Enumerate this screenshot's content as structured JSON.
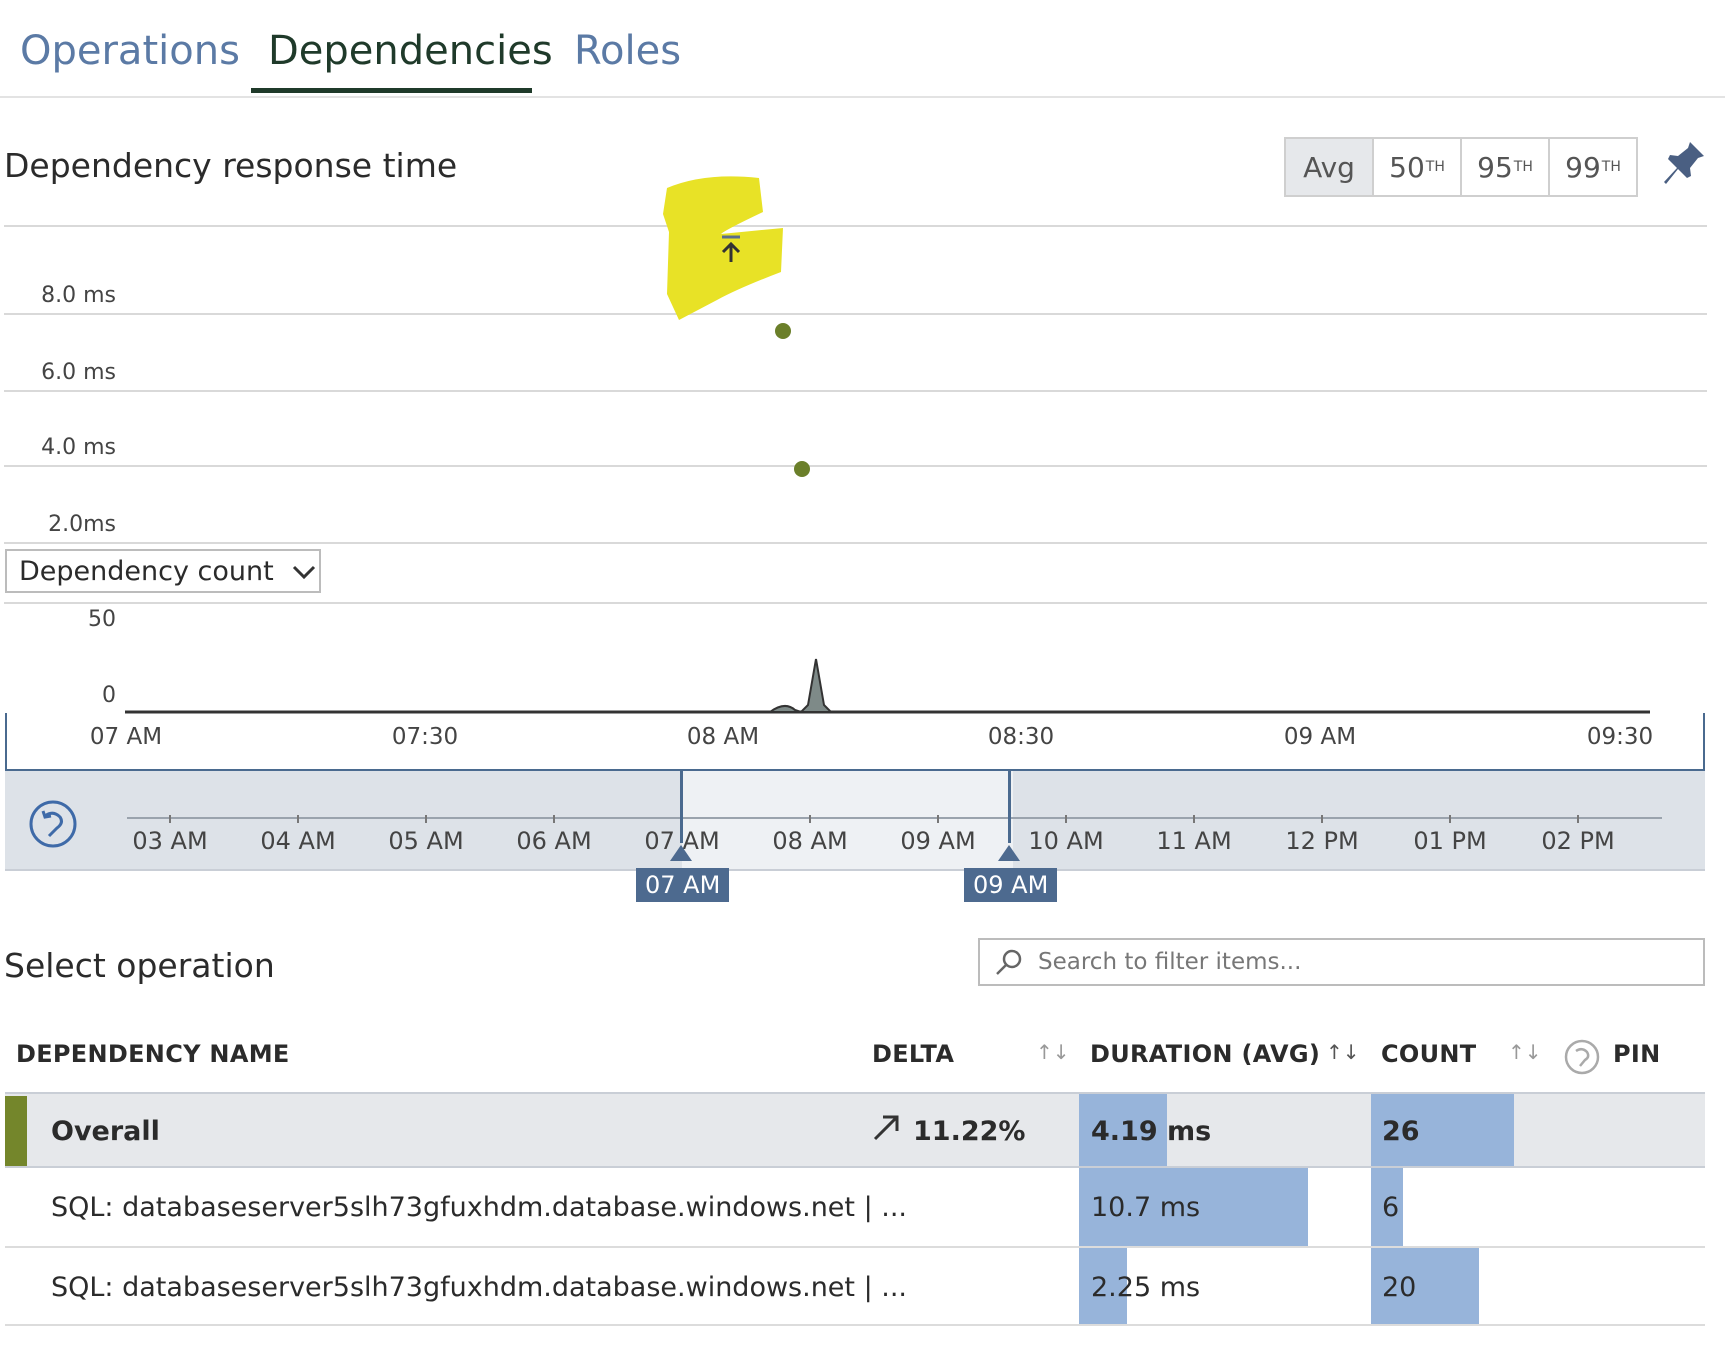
{
  "tabs": [
    {
      "label": "Operations"
    },
    {
      "label": "Dependencies"
    },
    {
      "label": "Roles"
    }
  ],
  "response_chart": {
    "title": "Dependency response time",
    "percentiles": [
      {
        "label": "Avg",
        "sup": ""
      },
      {
        "label": "50",
        "sup": "TH"
      },
      {
        "label": "95",
        "sup": "TH"
      },
      {
        "label": "99",
        "sup": "TH"
      }
    ],
    "selected_percentile": "Avg",
    "y_ticks": [
      "8.0 ms",
      "6.0 ms",
      "4.0 ms",
      "2.0ms"
    ],
    "point_color": "#6b7f2a"
  },
  "count_chart": {
    "metric_select": "Dependency count",
    "y_ticks": [
      "50",
      "0"
    ],
    "x_ticks": [
      "07 AM",
      "07:30",
      "08 AM",
      "08:30",
      "09 AM",
      "09:30"
    ]
  },
  "timeline": {
    "x_ticks": [
      "03 AM",
      "04 AM",
      "05 AM",
      "06 AM",
      "07 AM",
      "08 AM",
      "09 AM",
      "10 AM",
      "11 AM",
      "12 PM",
      "01 PM",
      "02 PM"
    ],
    "range_start": "07 AM",
    "range_end": "09 AM"
  },
  "operations": {
    "title": "Select operation",
    "search_placeholder": "Search to filter items...",
    "columns": {
      "name": "DEPENDENCY NAME",
      "delta": "DELTA",
      "duration": "DURATION (AVG)",
      "count": "COUNT",
      "pin": "PIN"
    },
    "rows": [
      {
        "name": "Overall",
        "delta": "11.22%",
        "duration": "4.19 ms",
        "count": "26",
        "duration_fraction": 0.39,
        "count_fraction": 0.43
      },
      {
        "name": "SQL: databaseserver5slh73gfuxhdm.database.windows.net | ...",
        "delta": "",
        "duration": "10.7 ms",
        "count": "6",
        "duration_fraction": 1.0,
        "count_fraction": 0.1
      },
      {
        "name": "SQL: databaseserver5slh73gfuxhdm.database.windows.net | ...",
        "delta": "",
        "duration": "2.25 ms",
        "count": "20",
        "duration_fraction": 0.21,
        "count_fraction": 0.33
      }
    ],
    "accent_color": "#74862b",
    "bar_color": "#97b4da"
  }
}
